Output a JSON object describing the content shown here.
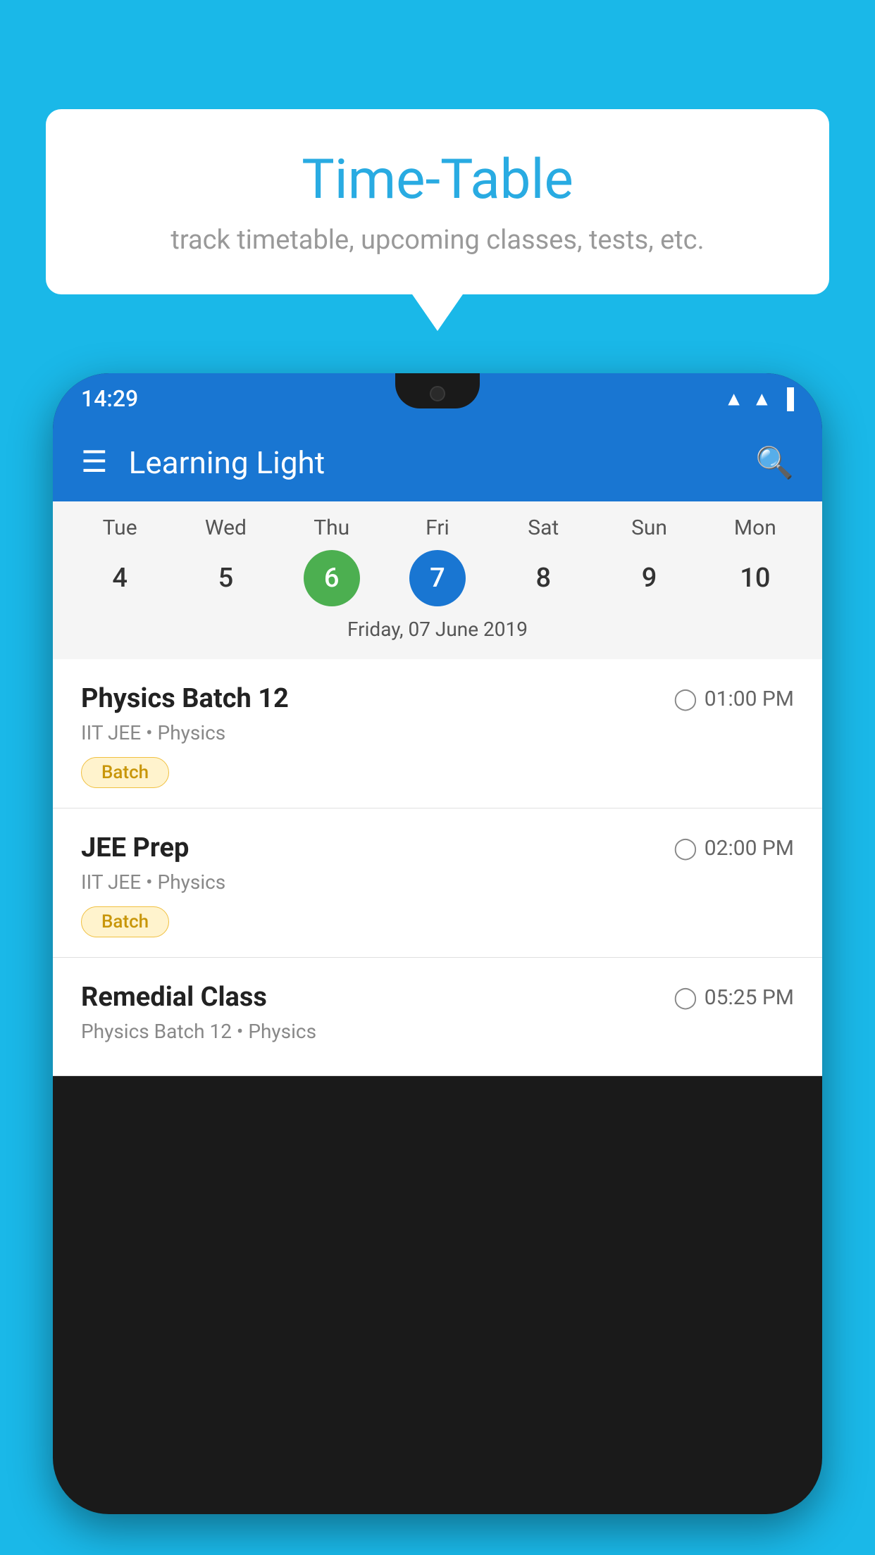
{
  "background": {
    "color": "#1ab8e8"
  },
  "speech_bubble": {
    "title": "Time-Table",
    "subtitle": "track timetable, upcoming classes, tests, etc."
  },
  "phone": {
    "status_bar": {
      "time": "14:29"
    },
    "app_bar": {
      "title": "Learning Light"
    },
    "calendar": {
      "days": [
        "Tue",
        "Wed",
        "Thu",
        "Fri",
        "Sat",
        "Sun",
        "Mon"
      ],
      "dates": [
        "4",
        "5",
        "6",
        "7",
        "8",
        "9",
        "10"
      ],
      "today_index": 2,
      "selected_index": 3,
      "selected_label": "Friday, 07 June 2019"
    },
    "schedule_items": [
      {
        "title": "Physics Batch 12",
        "time": "01:00 PM",
        "subtitle": "IIT JEE • Physics",
        "badge": "Batch"
      },
      {
        "title": "JEE Prep",
        "time": "02:00 PM",
        "subtitle": "IIT JEE • Physics",
        "badge": "Batch"
      },
      {
        "title": "Remedial Class",
        "time": "05:25 PM",
        "subtitle": "Physics Batch 12 • Physics",
        "badge": null
      }
    ]
  }
}
